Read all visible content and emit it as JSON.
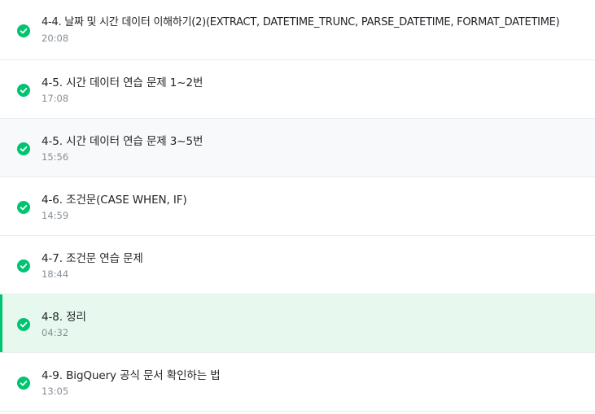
{
  "lectures": [
    {
      "title": "4-4. 날짜 및 시간 데이터 이해하기(2)(EXTRACT, DATETIME_TRUNC, PARSE_DATETIME, FORMAT_DATETIME)",
      "duration": "20:08",
      "completed": true,
      "state": "default"
    },
    {
      "title": "4-5. 시간 데이터 연습 문제 1~2번",
      "duration": "17:08",
      "completed": true,
      "state": "default"
    },
    {
      "title": "4-5. 시간 데이터 연습 문제 3~5번",
      "duration": "15:56",
      "completed": true,
      "state": "hover"
    },
    {
      "title": "4-6. 조건문(CASE WHEN, IF)",
      "duration": "14:59",
      "completed": true,
      "state": "default"
    },
    {
      "title": "4-7. 조건문 연습 문제",
      "duration": "18:44",
      "completed": true,
      "state": "default"
    },
    {
      "title": "4-8. 정리",
      "duration": "04:32",
      "completed": true,
      "state": "active"
    },
    {
      "title": "4-9. BigQuery 공식 문서 확인하는 법",
      "duration": "13:05",
      "completed": true,
      "state": "default"
    }
  ],
  "icons": {
    "completed": "check-circle-icon"
  },
  "colors": {
    "accent": "#00c471",
    "active_bg": "#e7f8ee",
    "hover_bg": "#f8f9fa"
  }
}
